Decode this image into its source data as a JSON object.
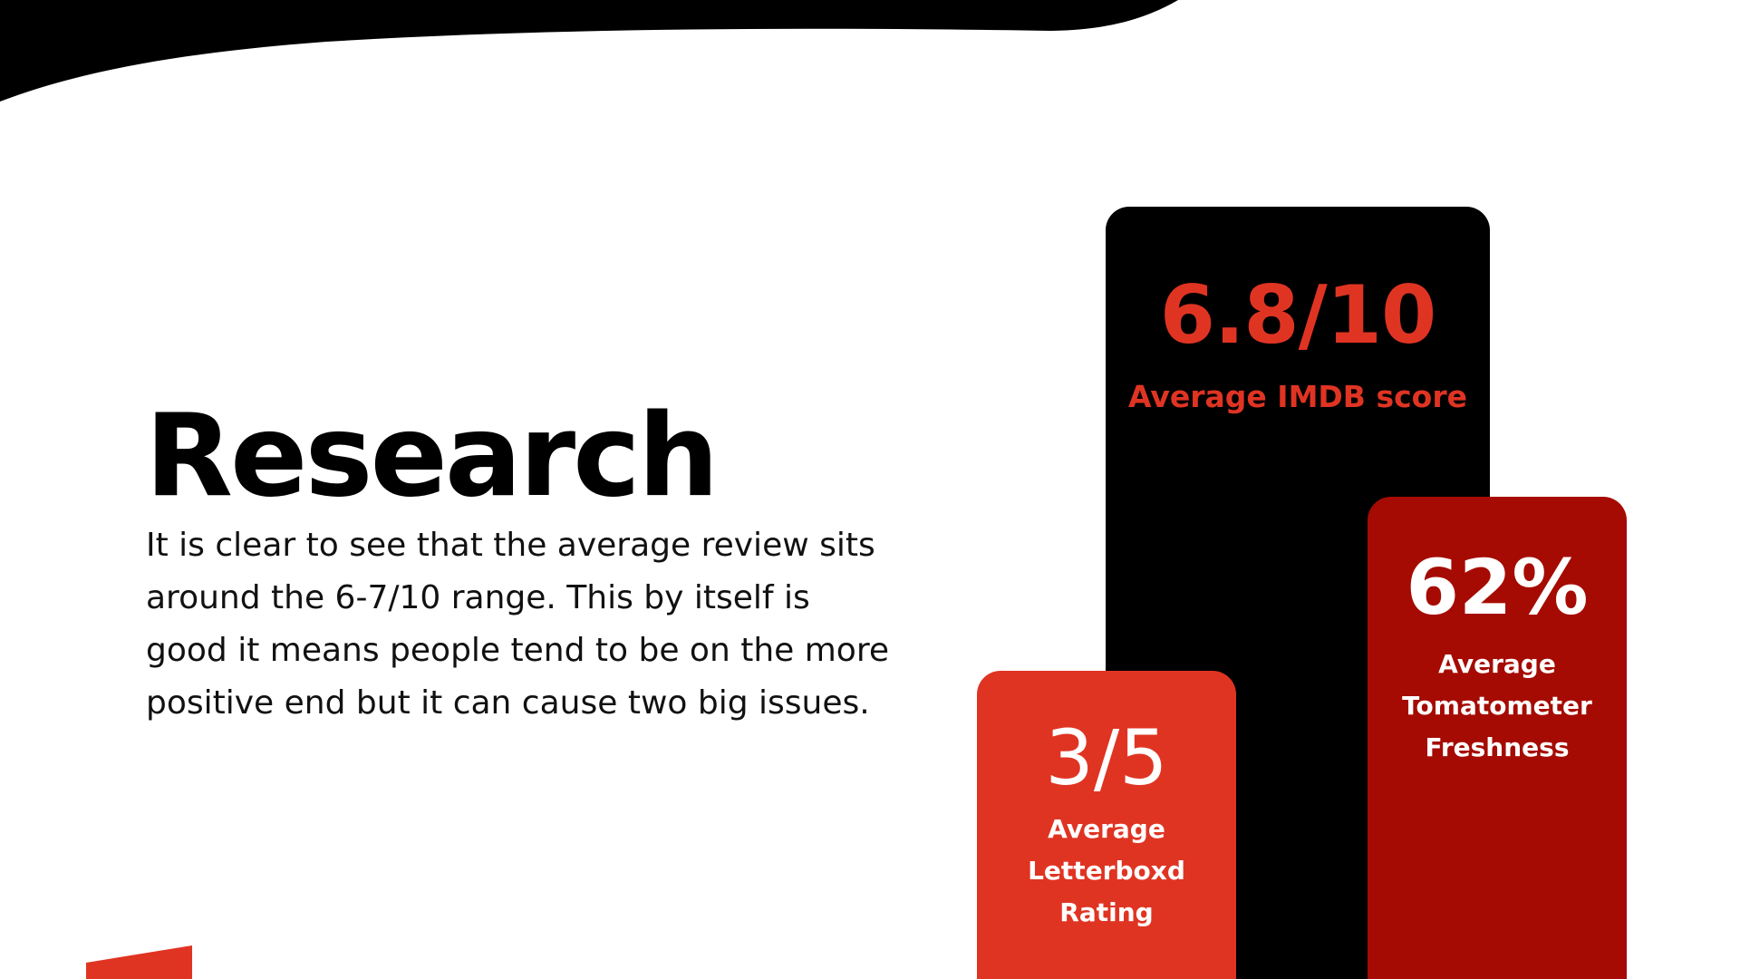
{
  "slide": {
    "title": "Research",
    "body": "It is clear to see that the average review sits around the 6-7/10 range. This by itself is good it means people tend to be on the more positive end but it can cause two big issues."
  },
  "stats": {
    "imdb": {
      "value": "6.8/10",
      "label": "Average IMDB score"
    },
    "tomatometer": {
      "value": "62%",
      "label": "Average Tomatometer Freshness"
    },
    "letterboxd": {
      "value": "3/5",
      "label": "Average Letterboxd Rating"
    }
  },
  "colors": {
    "black": "#000000",
    "accent_red": "#e03423",
    "dark_red": "#a50b02",
    "background": "#ffffff"
  }
}
